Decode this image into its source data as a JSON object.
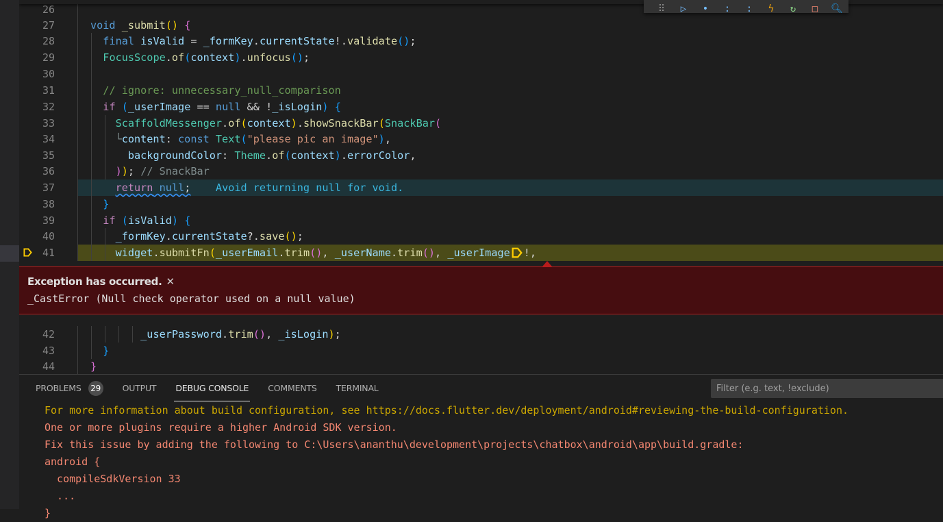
{
  "editor": {
    "lines": [
      {
        "num": "26",
        "segments": []
      },
      {
        "num": "27",
        "segments": [
          {
            "cls": "k",
            "text": "void"
          },
          {
            "cls": "",
            "text": " "
          },
          {
            "cls": "f",
            "text": "_submit"
          },
          {
            "cls": "p1",
            "text": "()"
          },
          {
            "cls": "",
            "text": " "
          },
          {
            "cls": "p2",
            "text": "{"
          }
        ]
      },
      {
        "num": "28",
        "segments": [
          {
            "cls": "",
            "text": "  "
          },
          {
            "cls": "k",
            "text": "final"
          },
          {
            "cls": "",
            "text": " "
          },
          {
            "cls": "v",
            "text": "isValid"
          },
          {
            "cls": "",
            "text": " = "
          },
          {
            "cls": "v",
            "text": "_formKey"
          },
          {
            "cls": "",
            "text": "."
          },
          {
            "cls": "v",
            "text": "currentState"
          },
          {
            "cls": "",
            "text": "!."
          },
          {
            "cls": "f",
            "text": "validate"
          },
          {
            "cls": "p3",
            "text": "()"
          },
          {
            "cls": "",
            "text": ";"
          }
        ]
      },
      {
        "num": "29",
        "segments": [
          {
            "cls": "",
            "text": "  "
          },
          {
            "cls": "t",
            "text": "FocusScope"
          },
          {
            "cls": "",
            "text": "."
          },
          {
            "cls": "f",
            "text": "of"
          },
          {
            "cls": "p3",
            "text": "("
          },
          {
            "cls": "v",
            "text": "context"
          },
          {
            "cls": "p3",
            "text": ")"
          },
          {
            "cls": "",
            "text": "."
          },
          {
            "cls": "f",
            "text": "unfocus"
          },
          {
            "cls": "p3",
            "text": "()"
          },
          {
            "cls": "",
            "text": ";"
          }
        ]
      },
      {
        "num": "30",
        "segments": []
      },
      {
        "num": "31",
        "segments": [
          {
            "cls": "",
            "text": "  "
          },
          {
            "cls": "c",
            "text": "// ignore: unnecessary_null_comparison"
          }
        ]
      },
      {
        "num": "32",
        "segments": [
          {
            "cls": "",
            "text": "  "
          },
          {
            "cls": "ctl",
            "text": "if"
          },
          {
            "cls": "",
            "text": " "
          },
          {
            "cls": "p3",
            "text": "("
          },
          {
            "cls": "v",
            "text": "_userImage"
          },
          {
            "cls": "",
            "text": " == "
          },
          {
            "cls": "k",
            "text": "null"
          },
          {
            "cls": "",
            "text": " && !"
          },
          {
            "cls": "v",
            "text": "_isLogin"
          },
          {
            "cls": "p3",
            "text": ")"
          },
          {
            "cls": "",
            "text": " "
          },
          {
            "cls": "p3",
            "text": "{"
          }
        ]
      },
      {
        "num": "33",
        "segments": [
          {
            "cls": "",
            "text": "    "
          },
          {
            "cls": "t",
            "text": "ScaffoldMessenger"
          },
          {
            "cls": "",
            "text": "."
          },
          {
            "cls": "f",
            "text": "of"
          },
          {
            "cls": "p1",
            "text": "("
          },
          {
            "cls": "v",
            "text": "context"
          },
          {
            "cls": "p1",
            "text": ")"
          },
          {
            "cls": "",
            "text": "."
          },
          {
            "cls": "f",
            "text": "showSnackBar"
          },
          {
            "cls": "p1",
            "text": "("
          },
          {
            "cls": "t",
            "text": "SnackBar"
          },
          {
            "cls": "p2",
            "text": "("
          }
        ]
      },
      {
        "num": "34",
        "segments": [
          {
            "cls": "cm",
            "text": "    └"
          },
          {
            "cls": "v",
            "text": "content"
          },
          {
            "cls": "",
            "text": ": "
          },
          {
            "cls": "k",
            "text": "const"
          },
          {
            "cls": "",
            "text": " "
          },
          {
            "cls": "t",
            "text": "Text"
          },
          {
            "cls": "p3",
            "text": "("
          },
          {
            "cls": "s",
            "text": "\"please pic an image\""
          },
          {
            "cls": "p3",
            "text": ")"
          },
          {
            "cls": "",
            "text": ","
          }
        ]
      },
      {
        "num": "35",
        "segments": [
          {
            "cls": "",
            "text": "      "
          },
          {
            "cls": "v",
            "text": "backgroundColor"
          },
          {
            "cls": "",
            "text": ": "
          },
          {
            "cls": "t",
            "text": "Theme"
          },
          {
            "cls": "",
            "text": "."
          },
          {
            "cls": "f",
            "text": "of"
          },
          {
            "cls": "p3",
            "text": "("
          },
          {
            "cls": "v",
            "text": "context"
          },
          {
            "cls": "p3",
            "text": ")"
          },
          {
            "cls": "",
            "text": "."
          },
          {
            "cls": "v",
            "text": "errorColor"
          },
          {
            "cls": "",
            "text": ","
          }
        ]
      },
      {
        "num": "36",
        "segments": [
          {
            "cls": "",
            "text": "    "
          },
          {
            "cls": "p2",
            "text": ")"
          },
          {
            "cls": "p1",
            "text": ")"
          },
          {
            "cls": "",
            "text": "; "
          },
          {
            "cls": "cm",
            "text": "// SnackBar"
          }
        ]
      },
      {
        "num": "37",
        "segments": [
          {
            "cls": "",
            "text": "    "
          },
          {
            "cls": "ctl squiggle",
            "text": "return"
          },
          {
            "cls": "squiggle",
            "text": " "
          },
          {
            "cls": "k squiggle",
            "text": "null"
          },
          {
            "cls": "squiggle",
            "text": ";"
          },
          {
            "cls": "",
            "text": "    "
          },
          {
            "cls": "inline-msg",
            "text": "Avoid returning null for void."
          }
        ]
      },
      {
        "num": "38",
        "segments": [
          {
            "cls": "",
            "text": "  "
          },
          {
            "cls": "p3",
            "text": "}"
          }
        ]
      },
      {
        "num": "39",
        "segments": [
          {
            "cls": "",
            "text": "  "
          },
          {
            "cls": "ctl",
            "text": "if"
          },
          {
            "cls": "",
            "text": " "
          },
          {
            "cls": "p3",
            "text": "("
          },
          {
            "cls": "v",
            "text": "isValid"
          },
          {
            "cls": "p3",
            "text": ")"
          },
          {
            "cls": "",
            "text": " "
          },
          {
            "cls": "p3",
            "text": "{"
          }
        ]
      },
      {
        "num": "40",
        "segments": [
          {
            "cls": "",
            "text": "    "
          },
          {
            "cls": "v",
            "text": "_formKey"
          },
          {
            "cls": "",
            "text": "."
          },
          {
            "cls": "v",
            "text": "currentState"
          },
          {
            "cls": "",
            "text": "?."
          },
          {
            "cls": "f",
            "text": "save"
          },
          {
            "cls": "p1",
            "text": "()"
          },
          {
            "cls": "",
            "text": ";"
          }
        ]
      },
      {
        "num": "41",
        "segments": [
          {
            "cls": "",
            "text": "    "
          },
          {
            "cls": "v",
            "text": "widget"
          },
          {
            "cls": "",
            "text": "."
          },
          {
            "cls": "f",
            "text": "submitFn"
          },
          {
            "cls": "p1",
            "text": "("
          },
          {
            "cls": "v",
            "text": "_userEmail"
          },
          {
            "cls": "",
            "text": "."
          },
          {
            "cls": "f",
            "text": "trim"
          },
          {
            "cls": "p2",
            "text": "()"
          },
          {
            "cls": "",
            "text": ", "
          },
          {
            "cls": "v",
            "text": "_userName"
          },
          {
            "cls": "",
            "text": "."
          },
          {
            "cls": "f",
            "text": "trim"
          },
          {
            "cls": "p2",
            "text": "()"
          },
          {
            "cls": "",
            "text": ", "
          },
          {
            "cls": "v",
            "text": "_userImage"
          }
        ],
        "after_marker": "!,"
      },
      {
        "num": "42",
        "segments": [
          {
            "cls": "",
            "text": "        "
          },
          {
            "cls": "v",
            "text": "_userPassword"
          },
          {
            "cls": "",
            "text": "."
          },
          {
            "cls": "f",
            "text": "trim"
          },
          {
            "cls": "p2",
            "text": "()"
          },
          {
            "cls": "",
            "text": ", "
          },
          {
            "cls": "v",
            "text": "_isLogin"
          },
          {
            "cls": "p1",
            "text": ")"
          },
          {
            "cls": "",
            "text": ";"
          }
        ]
      },
      {
        "num": "43",
        "segments": [
          {
            "cls": "",
            "text": "  "
          },
          {
            "cls": "p3",
            "text": "}"
          }
        ]
      },
      {
        "num": "44",
        "segments": [
          {
            "cls": "p2",
            "text": "}"
          }
        ]
      }
    ]
  },
  "exception": {
    "title": "Exception has occurred.",
    "close_glyph": "✕",
    "message": "_CastError (Null check operator used on a null value)"
  },
  "debug_toolbar": {
    "buttons": [
      {
        "name": "drag-handle-icon",
        "glyph": "⠿",
        "color": "#858585"
      },
      {
        "name": "continue-icon",
        "glyph": "▷",
        "color": "#75beff"
      },
      {
        "name": "step-over-icon",
        "glyph": "•",
        "color": "#75beff"
      },
      {
        "name": "step-into-icon",
        "glyph": ":",
        "color": "#75beff"
      },
      {
        "name": "step-out-icon",
        "glyph": ":",
        "color": "#75beff"
      },
      {
        "name": "hot-reload-icon",
        "glyph": "ϟ",
        "color": "#f0a30a"
      },
      {
        "name": "restart-icon",
        "glyph": "↻",
        "color": "#89d185"
      },
      {
        "name": "stop-icon",
        "glyph": "□",
        "color": "#f48771"
      },
      {
        "name": "devtools-search-icon",
        "glyph": "🔍︎",
        "color": "#1e9ef0"
      }
    ]
  },
  "panel": {
    "tabs": [
      {
        "label": "PROBLEMS",
        "badge": "29",
        "active": false
      },
      {
        "label": "OUTPUT",
        "active": false
      },
      {
        "label": "DEBUG CONSOLE",
        "active": true
      },
      {
        "label": "COMMENTS",
        "active": false
      },
      {
        "label": "TERMINAL",
        "active": false
      }
    ],
    "filter_placeholder": "Filter (e.g. text, !exclude)",
    "console_lines": [
      {
        "color": "yellow",
        "text": "For more information about build configuration, see https://docs.flutter.dev/deployment/android#reviewing-the-build-configuration."
      },
      {
        "color": "red",
        "text": "One or more plugins require a higher Android SDK version."
      },
      {
        "color": "red",
        "text": "Fix this issue by adding the following to C:\\Users\\ananthu\\development\\projects\\chatbox\\android\\app\\build.gradle:"
      },
      {
        "color": "red",
        "text": "android {"
      },
      {
        "color": "red",
        "text": "  compileSdkVersion 33"
      },
      {
        "color": "red",
        "text": "  ..."
      },
      {
        "color": "red",
        "text": "}"
      }
    ]
  },
  "colors": {
    "exception_bg": "#460d10",
    "exception_border": "#b71c1c",
    "current_line_bg": "#4b4b18",
    "warning_line_bg": "#1d3439",
    "breakpoint_marker": "#ffcc00"
  }
}
